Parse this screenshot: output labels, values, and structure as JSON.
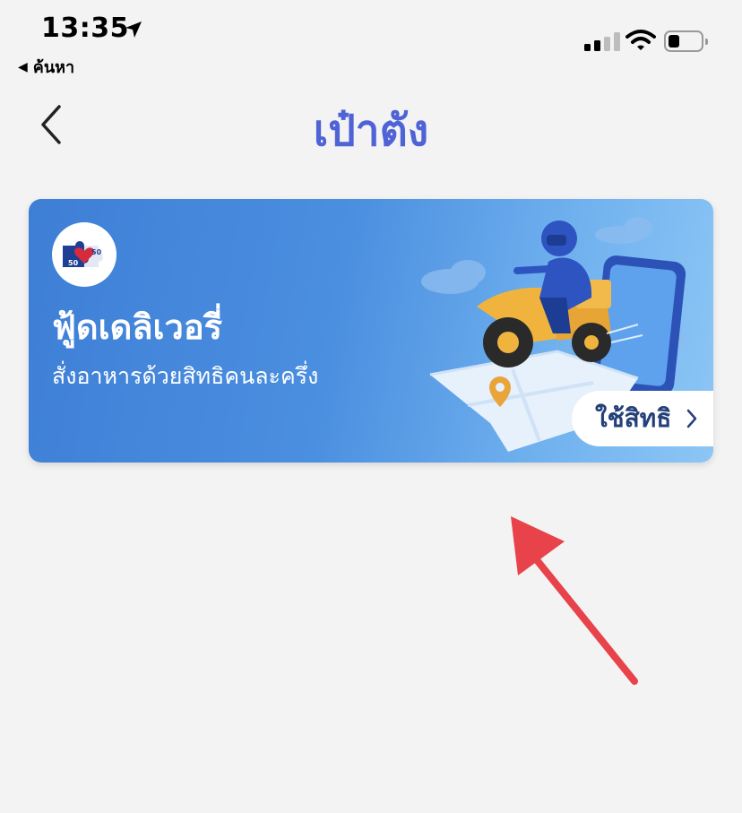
{
  "status_bar": {
    "time": "13:35",
    "back_app_label": "ค้นหา"
  },
  "header": {
    "title": "เป๋าตัง"
  },
  "banner": {
    "title": "ฟู้ดเดลิเวอรี่",
    "subtitle": "สั่งอาหารด้วยสิทธิคนละครึ่ง",
    "button_label": "ใช้สิทธิ",
    "logo_text": "50 50"
  },
  "colors": {
    "title": "#4f63d6",
    "banner_start": "#3e7fd6",
    "banner_end": "#8cc6f5",
    "button_text": "#24407a",
    "annotation_arrow": "#e8424a"
  }
}
